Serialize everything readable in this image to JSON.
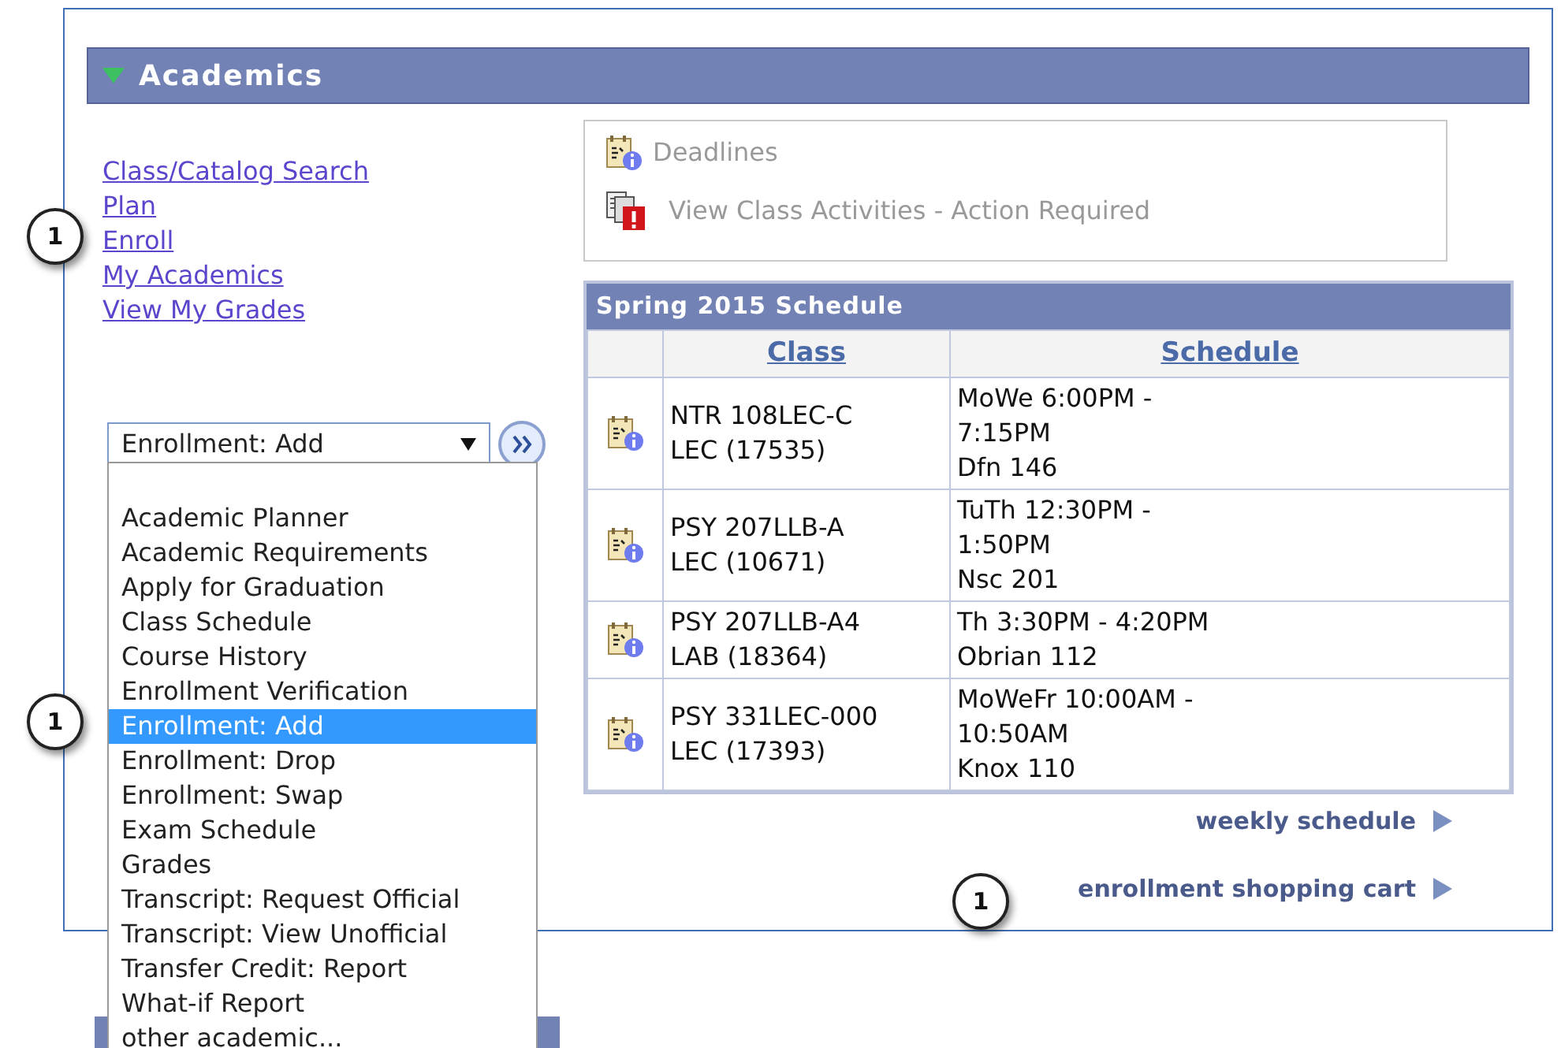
{
  "section": {
    "title": "Academics",
    "expanded": true
  },
  "links": [
    "Class/Catalog Search",
    "Plan",
    "Enroll",
    "My Academics",
    "View My Grades"
  ],
  "dropdown": {
    "value": "Enrollment: Add",
    "open": true,
    "options": [
      {
        "label": "Academic Planner",
        "selected": false
      },
      {
        "label": "Academic Requirements",
        "selected": false
      },
      {
        "label": "Apply for Graduation",
        "selected": false
      },
      {
        "label": "Class Schedule",
        "selected": false
      },
      {
        "label": "Course History",
        "selected": false
      },
      {
        "label": "Enrollment Verification",
        "selected": false
      },
      {
        "label": "Enrollment: Add",
        "selected": true
      },
      {
        "label": "Enrollment: Drop",
        "selected": false
      },
      {
        "label": "Enrollment: Swap",
        "selected": false
      },
      {
        "label": "Exam Schedule",
        "selected": false
      },
      {
        "label": "Grades",
        "selected": false
      },
      {
        "label": "Transcript: Request Official",
        "selected": false
      },
      {
        "label": "Transcript: View Unofficial",
        "selected": false
      },
      {
        "label": "Transfer Credit: Report",
        "selected": false
      },
      {
        "label": "What-if Report",
        "selected": false
      },
      {
        "label": "other academic...",
        "selected": false
      }
    ]
  },
  "notices": [
    {
      "kind": "info",
      "label": "Deadlines"
    },
    {
      "kind": "alert",
      "label": "View Class Activities - Action Required"
    }
  ],
  "schedule": {
    "title": "Spring 2015 Schedule",
    "columns": [
      "Class",
      "Schedule"
    ],
    "rows": [
      {
        "class": [
          "NTR 108LEC-C",
          "LEC (17535)"
        ],
        "schedule": [
          "MoWe 6:00PM -",
          "7:15PM",
          "Dfn 146"
        ]
      },
      {
        "class": [
          "PSY 207LLB-A",
          "LEC (10671)"
        ],
        "schedule": [
          "TuTh 12:30PM -",
          "1:50PM",
          "Nsc 201"
        ]
      },
      {
        "class": [
          "PSY 207LLB-A4",
          "LAB (18364)"
        ],
        "schedule": [
          "Th 3:30PM - 4:20PM",
          "Obrian 112"
        ]
      },
      {
        "class": [
          "PSY 331LEC-000",
          "LEC (17393)"
        ],
        "schedule": [
          "MoWeFr 10:00AM -",
          "10:50AM",
          "Knox 110"
        ]
      }
    ]
  },
  "footer_links": [
    "weekly schedule",
    "enrollment shopping cart"
  ],
  "callouts": [
    "1",
    "1",
    "1"
  ]
}
